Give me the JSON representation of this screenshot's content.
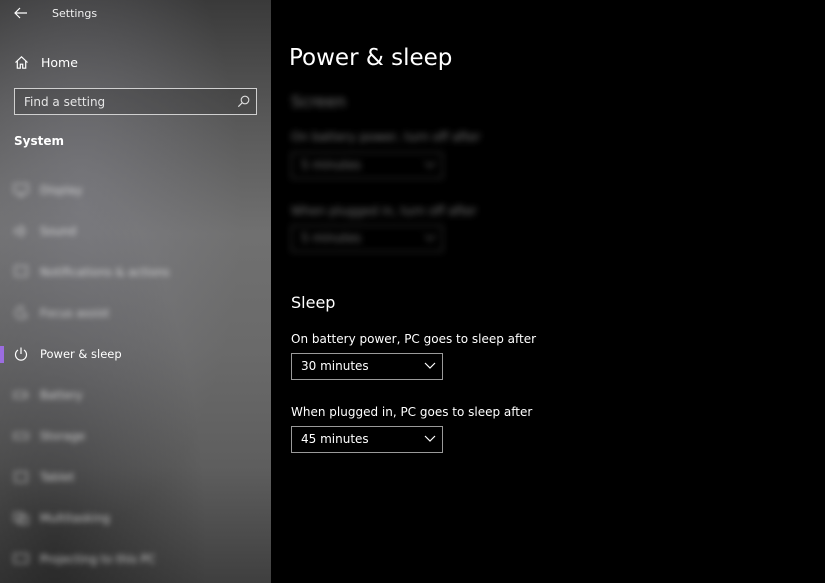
{
  "window": {
    "title": "Settings"
  },
  "sidebar": {
    "home_label": "Home",
    "search": {
      "placeholder": "Find a setting"
    },
    "section_heading": "System",
    "items": [
      {
        "label": "Display",
        "icon": "monitor-icon",
        "selected": false,
        "blurred": true
      },
      {
        "label": "Sound",
        "icon": "speaker-icon",
        "selected": false,
        "blurred": true
      },
      {
        "label": "Notifications & actions",
        "icon": "notification-icon",
        "selected": false,
        "blurred": true
      },
      {
        "label": "Focus assist",
        "icon": "moon-icon",
        "selected": false,
        "blurred": true
      },
      {
        "label": "Power & sleep",
        "icon": "power-icon",
        "selected": true,
        "blurred": false
      },
      {
        "label": "Battery",
        "icon": "battery-icon",
        "selected": false,
        "blurred": true
      },
      {
        "label": "Storage",
        "icon": "storage-icon",
        "selected": false,
        "blurred": true
      },
      {
        "label": "Tablet",
        "icon": "tablet-icon",
        "selected": false,
        "blurred": true
      },
      {
        "label": "Multitasking",
        "icon": "multitasking-icon",
        "selected": false,
        "blurred": true
      },
      {
        "label": "Projecting to this PC",
        "icon": "projector-icon",
        "selected": false,
        "blurred": true
      }
    ],
    "accent_color": "#9b6de0"
  },
  "main": {
    "page_title": "Power & sleep",
    "screen": {
      "heading": "Screen",
      "battery_label": "On battery power, turn off after",
      "battery_value": "5 minutes",
      "plugged_label": "When plugged in, turn off after",
      "plugged_value": "5 minutes"
    },
    "sleep": {
      "heading": "Sleep",
      "battery_label": "On battery power, PC goes to sleep after",
      "battery_value": "30 minutes",
      "plugged_label": "When plugged in, PC goes to sleep after",
      "plugged_value": "45 minutes"
    }
  }
}
